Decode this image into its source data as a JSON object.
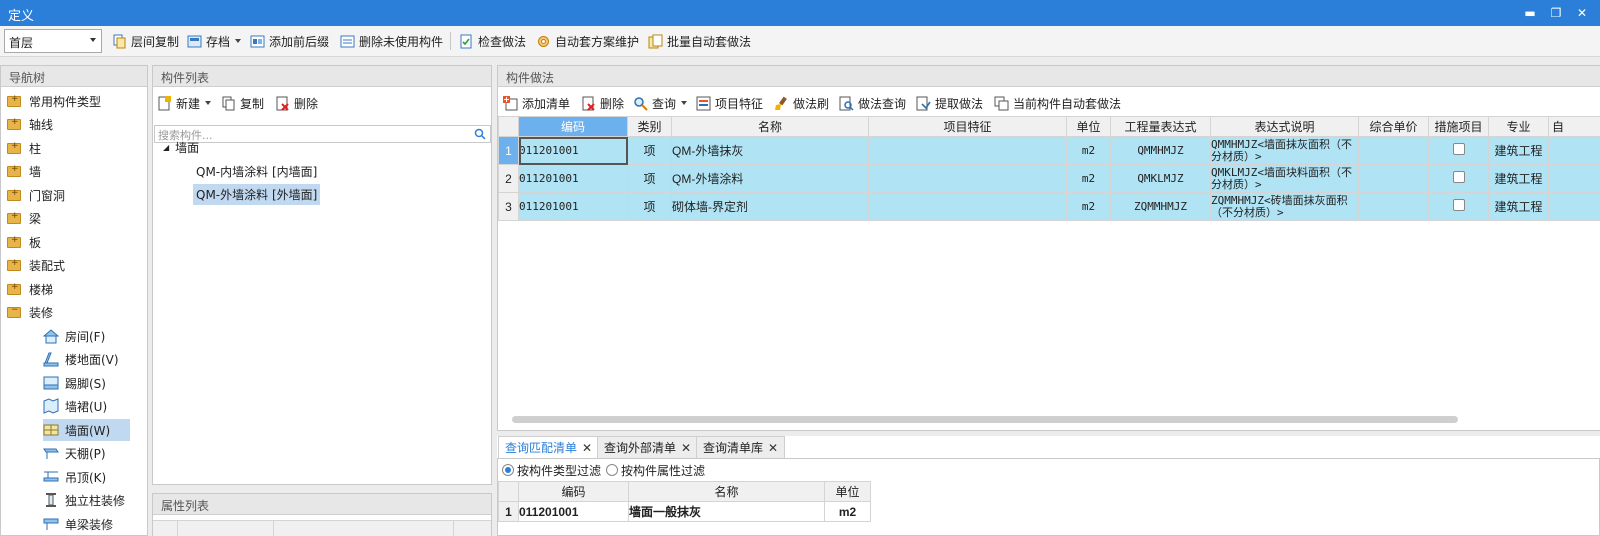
{
  "window": {
    "title": "定义",
    "minimize_glyph": "▬",
    "restore_glyph": "❐",
    "close_glyph": "✕"
  },
  "toolbar": {
    "floor": "首层",
    "items": [
      "层间复制",
      "存档",
      "添加前后缀",
      "删除未使用构件",
      "检查做法",
      "自动套方案维护",
      "批量自动套做法"
    ]
  },
  "nav": {
    "title": "导航树",
    "items": [
      "常用构件类型",
      "轴线",
      "柱",
      "墙",
      "门窗洞",
      "梁",
      "板",
      "装配式",
      "楼梯",
      "装修"
    ],
    "sub_items": [
      "房间(F)",
      "楼地面(V)",
      "踢脚(S)",
      "墙裙(U)",
      "墙面(W)",
      "天棚(P)",
      "吊顶(K)",
      "独立柱装修",
      "单梁装修"
    ]
  },
  "component_list": {
    "title": "构件列表",
    "actions": [
      "新建",
      "复制",
      "删除"
    ],
    "search_placeholder": "搜索构件...",
    "group": "墙面",
    "items": [
      "QM-内墙涂料 [内墙面]",
      "QM-外墙涂料 [外墙面]"
    ]
  },
  "properties": {
    "title": "属性列表"
  },
  "method": {
    "title": "构件做法",
    "actions": [
      "添加清单",
      "删除",
      "查询",
      "项目特征",
      "做法刷",
      "做法查询",
      "提取做法",
      "当前构件自动套做法"
    ],
    "columns": [
      "编码",
      "类别",
      "名称",
      "项目特征",
      "单位",
      "工程量表达式",
      "表达式说明",
      "综合单价",
      "措施项目",
      "专业",
      "自"
    ],
    "rows": [
      {
        "num": "1",
        "code": "011201001",
        "type": "项",
        "name": "QM-外墙抹灰",
        "feature": "",
        "unit": "m2",
        "expr": "QMMHMJZ",
        "desc": "QMMHMJZ<墙面抹灰面积（不分材质）>",
        "price": "",
        "measure": false,
        "major": "建筑工程"
      },
      {
        "num": "2",
        "code": "011201001",
        "type": "项",
        "name": "QM-外墙涂料",
        "feature": "",
        "unit": "m2",
        "expr": "QMKLMJZ",
        "desc": "QMKLMJZ<墙面块料面积（不分材质）>",
        "price": "",
        "measure": false,
        "major": "建筑工程"
      },
      {
        "num": "3",
        "code": "011201001",
        "type": "项",
        "name": "砌体墙-界定剂",
        "feature": "",
        "unit": "m2",
        "expr": "ZQMMHMJZ",
        "desc": "ZQMMHMJZ<砖墙面抹灰面积（不分材质）>",
        "price": "",
        "measure": false,
        "major": "建筑工程"
      }
    ]
  },
  "bottom": {
    "tabs": [
      "查询匹配清单",
      "查询外部清单",
      "查询清单库"
    ],
    "close_glyph": "✕",
    "filters": [
      "按构件类型过滤",
      "按构件属性过滤"
    ],
    "columns": [
      "编码",
      "名称",
      "单位"
    ],
    "rows": [
      {
        "num": "1",
        "code": "011201001",
        "name": "墙面一般抹灰",
        "unit": "m2"
      }
    ]
  }
}
